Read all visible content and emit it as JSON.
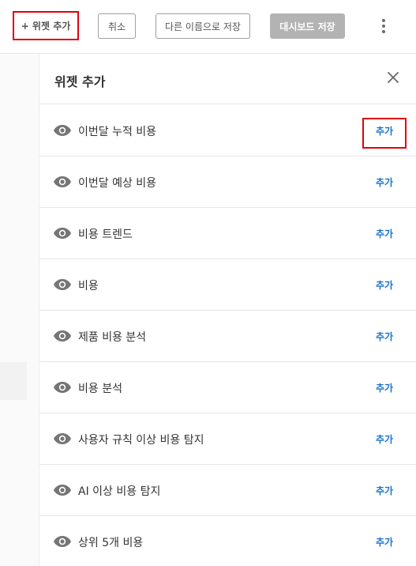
{
  "toolbar": {
    "add_widget_label": "+ 위젯 추가",
    "cancel_label": "취소",
    "save_as_label": "다른 이름으로 저장",
    "save_dashboard_label": "대시보드 저장"
  },
  "panel": {
    "title": "위젯 추가",
    "items": [
      {
        "label": "이번달 누적 비용",
        "action": "추가"
      },
      {
        "label": "이번달 예상 비용",
        "action": "추가"
      },
      {
        "label": "비용 트렌드",
        "action": "추가"
      },
      {
        "label": "비용",
        "action": "추가"
      },
      {
        "label": "제품 비용 분석",
        "action": "추가"
      },
      {
        "label": "비용 분석",
        "action": "추가"
      },
      {
        "label": "사용자 규칙 이상 비용 탐지",
        "action": "추가"
      },
      {
        "label": "AI 이상 비용 탐지",
        "action": "추가"
      },
      {
        "label": "상위 5개 비용",
        "action": "추가"
      }
    ]
  },
  "colors": {
    "highlight": "#e3000b",
    "link": "#1a73c9",
    "disabled_button": "#b3b3b3"
  }
}
